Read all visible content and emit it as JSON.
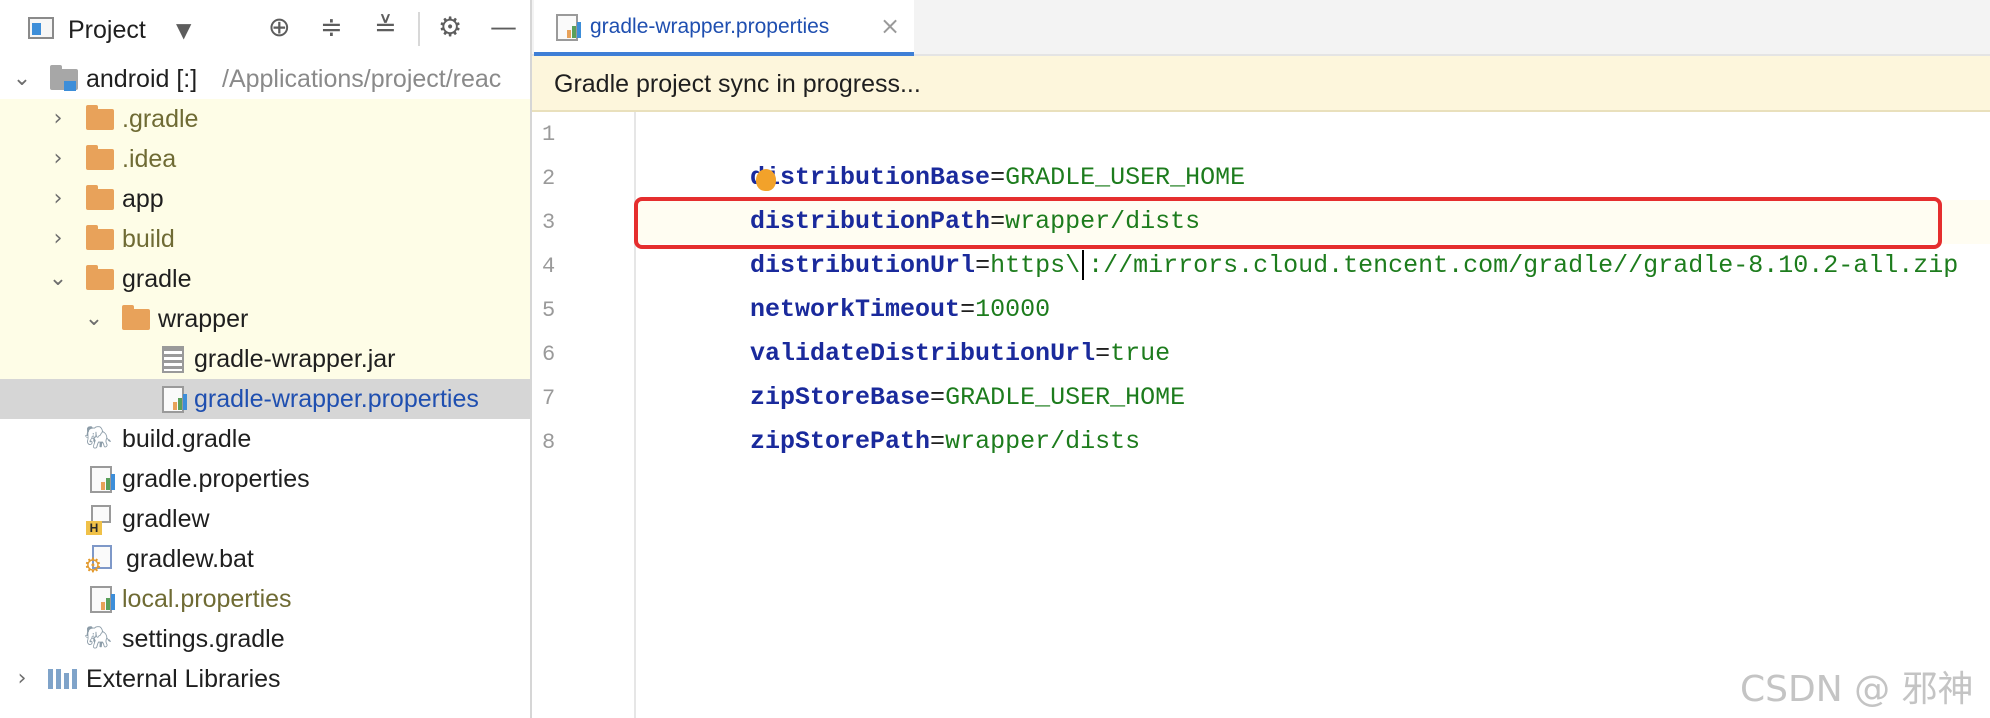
{
  "panel": {
    "title": "Project",
    "icons": [
      "project-icon",
      "dropdown-arrow-icon",
      "locate-icon",
      "expand-all-icon",
      "collapse-all-icon",
      "gear-icon",
      "minimize-icon"
    ]
  },
  "tree": {
    "root_name": "android [:]",
    "root_path": "/Applications/project/reac",
    "items": [
      {
        "label": ".gradle",
        "icon": "folder-icon",
        "expanded": false
      },
      {
        "label": ".idea",
        "icon": "folder-icon",
        "expanded": false
      },
      {
        "label": "app",
        "icon": "module-folder-icon",
        "expanded": false
      },
      {
        "label": "build",
        "icon": "folder-icon",
        "expanded": false
      },
      {
        "label": "gradle",
        "icon": "folder-icon",
        "expanded": true
      },
      {
        "label": "wrapper",
        "icon": "folder-icon",
        "expanded": true
      },
      {
        "label": "gradle-wrapper.jar",
        "icon": "jar-file-icon"
      },
      {
        "label": "gradle-wrapper.properties",
        "icon": "properties-file-icon",
        "selected": true
      },
      {
        "label": "build.gradle",
        "icon": "gradle-elephant-icon"
      },
      {
        "label": "gradle.properties",
        "icon": "properties-file-icon"
      },
      {
        "label": "gradlew",
        "icon": "shell-script-icon"
      },
      {
        "label": "gradlew.bat",
        "icon": "batch-file-icon"
      },
      {
        "label": "local.properties",
        "icon": "properties-file-icon"
      },
      {
        "label": "settings.gradle",
        "icon": "gradle-elephant-icon"
      },
      {
        "label": "External Libraries",
        "icon": "libraries-icon",
        "expanded": false
      }
    ]
  },
  "editor": {
    "tab_label": "gradle-wrapper.properties",
    "banner": "Gradle project sync in progress...",
    "line_numbers": [
      "1",
      "2",
      "3",
      "4",
      "5",
      "6",
      "7",
      "8"
    ],
    "lines": [
      {
        "key": "distributionBase",
        "value": "GRADLE_USER_HOME"
      },
      {
        "key": "distributionPath",
        "value": "wrapper/dists"
      },
      {
        "key": "distributionUrl",
        "value_a": "https\\",
        "value_b": "://mirrors.cloud.tencent.com/gradle//gradle-8.10.2-all.zip"
      },
      {
        "key": "networkTimeout",
        "value": "10000"
      },
      {
        "key": "validateDistributionUrl",
        "value": "true"
      },
      {
        "key": "zipStoreBase",
        "value": "GRADLE_USER_HOME"
      },
      {
        "key": "zipStorePath",
        "value": "wrapper/dists"
      }
    ],
    "eq": "="
  },
  "watermark": "CSDN @ 邪神",
  "colors": {
    "selection": "#d6d6d6",
    "highlight_border": "#e52e2e",
    "tab_accent": "#3f7fd6",
    "banner": "#fdf6dc",
    "key": "#1a2a9c",
    "value": "#1d7c1d"
  }
}
